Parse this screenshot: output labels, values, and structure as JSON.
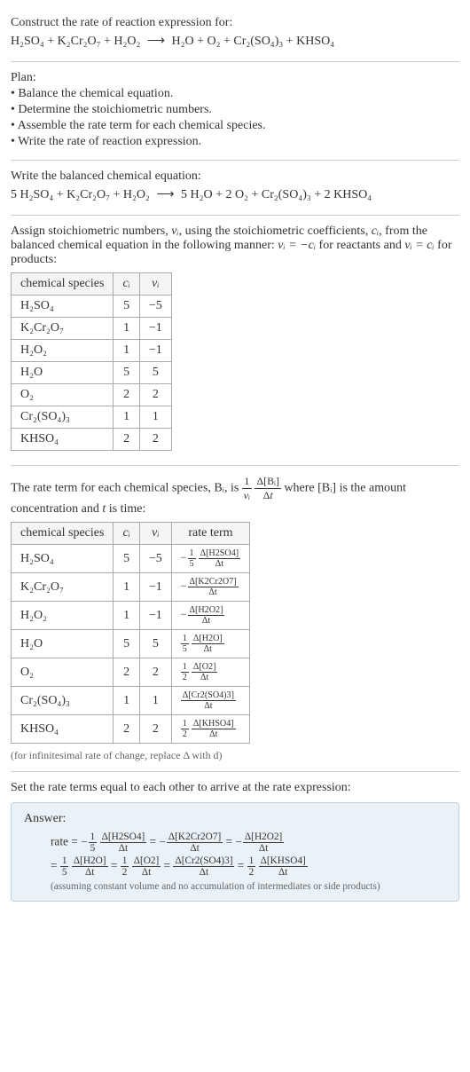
{
  "prompt": {
    "line1": "Construct the rate of reaction expression for:",
    "equation_lhs": "H₂SO₄ + K₂Cr₂O₇ + H₂O₂",
    "arrow": "⟶",
    "equation_rhs": "H₂O + O₂ + Cr₂(SO₄)₃ + KHSO₄"
  },
  "plan": {
    "label": "Plan:",
    "items": [
      "• Balance the chemical equation.",
      "• Determine the stoichiometric numbers.",
      "• Assemble the rate term for each chemical species.",
      "• Write the rate of reaction expression."
    ]
  },
  "balanced": {
    "intro": "Write the balanced chemical equation:",
    "equation_lhs": "5 H₂SO₄ + K₂Cr₂O₇ + H₂O₂",
    "arrow": "⟶",
    "equation_rhs": "5 H₂O + 2 O₂ + Cr₂(SO₄)₃ + 2 KHSO₄"
  },
  "stoich": {
    "intro_part1": "Assign stoichiometric numbers, ",
    "intro_nu": "νᵢ",
    "intro_part2": ", using the stoichiometric coefficients, ",
    "intro_c": "cᵢ",
    "intro_part3": ", from the balanced chemical equation in the following manner: ",
    "intro_react": "νᵢ = −cᵢ",
    "intro_part4": " for reactants and ",
    "intro_prod": "νᵢ = cᵢ",
    "intro_part5": " for products:",
    "headers": [
      "chemical species",
      "cᵢ",
      "νᵢ"
    ],
    "rows": [
      {
        "species": "H₂SO₄",
        "c": "5",
        "nu": "−5"
      },
      {
        "species": "K₂Cr₂O₇",
        "c": "1",
        "nu": "−1"
      },
      {
        "species": "H₂O₂",
        "c": "1",
        "nu": "−1"
      },
      {
        "species": "H₂O",
        "c": "5",
        "nu": "5"
      },
      {
        "species": "O₂",
        "c": "2",
        "nu": "2"
      },
      {
        "species": "Cr₂(SO₄)₃",
        "c": "1",
        "nu": "1"
      },
      {
        "species": "KHSO₄",
        "c": "2",
        "nu": "2"
      }
    ]
  },
  "rate_term": {
    "intro_part1": "The rate term for each chemical species, Bᵢ, is ",
    "intro_part2": " where [Bᵢ] is the amount concentration and ",
    "intro_t": "t",
    "intro_part3": " is time:",
    "headers": [
      "chemical species",
      "cᵢ",
      "νᵢ",
      "rate term"
    ],
    "rows": [
      {
        "species": "H₂SO₄",
        "c": "5",
        "nu": "−5",
        "sign": "−",
        "coef_num": "1",
        "coef_den": "5",
        "dnum": "Δ[H2SO4]",
        "dden": "Δt"
      },
      {
        "species": "K₂Cr₂O₇",
        "c": "1",
        "nu": "−1",
        "sign": "−",
        "coef_num": "",
        "coef_den": "",
        "dnum": "Δ[K2Cr2O7]",
        "dden": "Δt"
      },
      {
        "species": "H₂O₂",
        "c": "1",
        "nu": "−1",
        "sign": "−",
        "coef_num": "",
        "coef_den": "",
        "dnum": "Δ[H2O2]",
        "dden": "Δt"
      },
      {
        "species": "H₂O",
        "c": "5",
        "nu": "5",
        "sign": "",
        "coef_num": "1",
        "coef_den": "5",
        "dnum": "Δ[H2O]",
        "dden": "Δt"
      },
      {
        "species": "O₂",
        "c": "2",
        "nu": "2",
        "sign": "",
        "coef_num": "1",
        "coef_den": "2",
        "dnum": "Δ[O2]",
        "dden": "Δt"
      },
      {
        "species": "Cr₂(SO₄)₃",
        "c": "1",
        "nu": "1",
        "sign": "",
        "coef_num": "",
        "coef_den": "",
        "dnum": "Δ[Cr2(SO4)3]",
        "dden": "Δt"
      },
      {
        "species": "KHSO₄",
        "c": "2",
        "nu": "2",
        "sign": "",
        "coef_num": "1",
        "coef_den": "2",
        "dnum": "Δ[KHSO4]",
        "dden": "Δt"
      }
    ],
    "note": "(for infinitesimal rate of change, replace Δ with d)"
  },
  "final": {
    "intro": "Set the rate terms equal to each other to arrive at the rate expression:",
    "answer_label": "Answer:",
    "rate_prefix": "rate = ",
    "note": "(assuming constant volume and no accumulation of intermediates or side products)"
  },
  "chart_data": {
    "type": "table",
    "tables": [
      {
        "title": "Stoichiometric numbers",
        "headers": [
          "chemical species",
          "c_i",
          "nu_i"
        ],
        "rows": [
          [
            "H2SO4",
            5,
            -5
          ],
          [
            "K2Cr2O7",
            1,
            -1
          ],
          [
            "H2O2",
            1,
            -1
          ],
          [
            "H2O",
            5,
            5
          ],
          [
            "O2",
            2,
            2
          ],
          [
            "Cr2(SO4)3",
            1,
            1
          ],
          [
            "KHSO4",
            2,
            2
          ]
        ]
      },
      {
        "title": "Rate terms",
        "headers": [
          "chemical species",
          "c_i",
          "nu_i",
          "rate term"
        ],
        "rows": [
          [
            "H2SO4",
            5,
            -5,
            "-(1/5) d[H2SO4]/dt"
          ],
          [
            "K2Cr2O7",
            1,
            -1,
            "- d[K2Cr2O7]/dt"
          ],
          [
            "H2O2",
            1,
            -1,
            "- d[H2O2]/dt"
          ],
          [
            "H2O",
            5,
            5,
            "(1/5) d[H2O]/dt"
          ],
          [
            "O2",
            2,
            2,
            "(1/2) d[O2]/dt"
          ],
          [
            "Cr2(SO4)3",
            1,
            1,
            "d[Cr2(SO4)3]/dt"
          ],
          [
            "KHSO4",
            2,
            2,
            "(1/2) d[KHSO4]/dt"
          ]
        ]
      }
    ],
    "rate_expression": "rate = -(1/5) d[H2SO4]/dt = - d[K2Cr2O7]/dt = - d[H2O2]/dt = (1/5) d[H2O]/dt = (1/2) d[O2]/dt = d[Cr2(SO4)3]/dt = (1/2) d[KHSO4]/dt"
  }
}
